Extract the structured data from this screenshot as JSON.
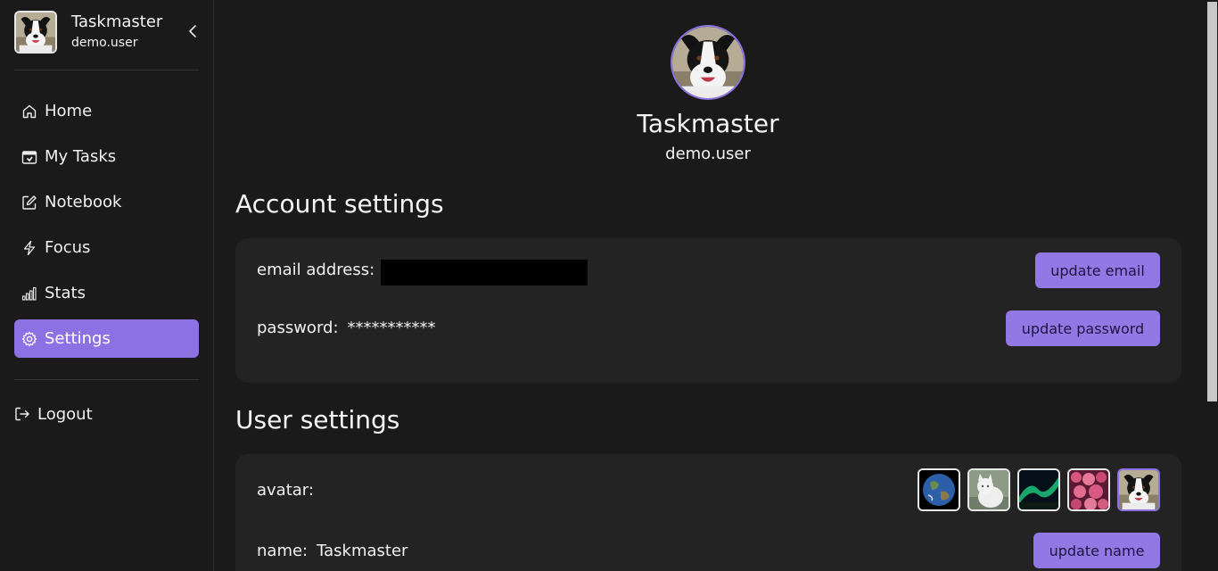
{
  "sidebar": {
    "app_title": "Taskmaster",
    "username": "demo.user",
    "nav": [
      {
        "label": "Home",
        "icon": "home-icon"
      },
      {
        "label": "My Tasks",
        "icon": "calendar-icon"
      },
      {
        "label": "Notebook",
        "icon": "edit-icon"
      },
      {
        "label": "Focus",
        "icon": "bolt-icon"
      },
      {
        "label": "Stats",
        "icon": "bar-chart-icon"
      },
      {
        "label": "Settings",
        "icon": "gear-icon",
        "active": true
      }
    ],
    "logout_label": "Logout"
  },
  "profile": {
    "name": "Taskmaster",
    "username": "demo.user"
  },
  "account_settings": {
    "title": "Account settings",
    "email_label": "email address:",
    "password_label": "password:",
    "password_value": "***********",
    "update_email_label": "update email",
    "update_password_label": "update password"
  },
  "user_settings": {
    "title": "User settings",
    "avatar_label": "avatar:",
    "avatar_options": [
      "earth",
      "white-cat",
      "aurora",
      "pink-flowers",
      "border-collie"
    ],
    "selected_avatar": "border-collie",
    "name_label": "name:",
    "name_value": "Taskmaster",
    "update_name_label": "update name"
  },
  "colors": {
    "background": "#1a1a1a",
    "card": "#232323",
    "accent": "#8b71e4"
  }
}
